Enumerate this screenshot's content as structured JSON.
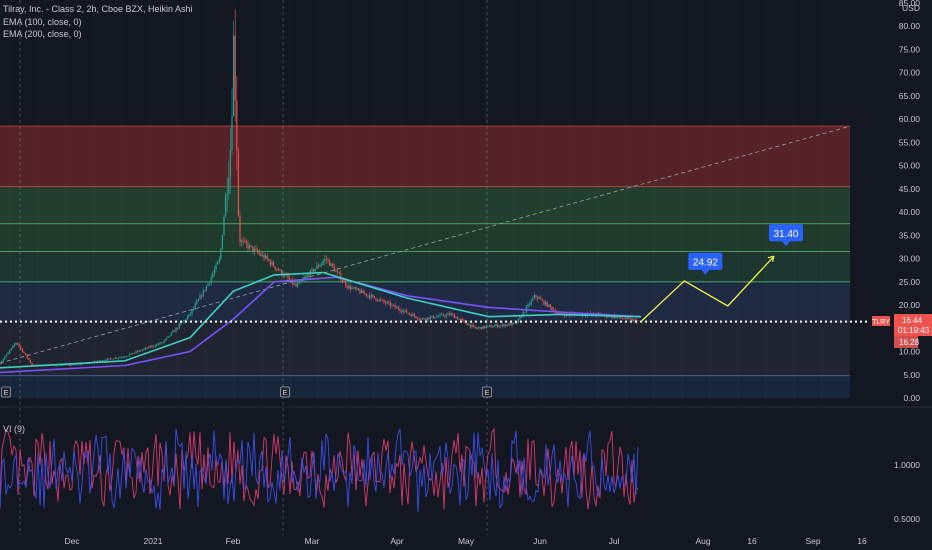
{
  "header": {
    "symbol_title": "Tilray, Inc. - Class 2, 2h, Cboe BZX, Heikin Ashi",
    "ema100_label": "EMA (100, close, 0)",
    "ema200_label": "EMA (200, close, 0)",
    "vi_label": "VI (9)"
  },
  "price_axis": {
    "currency": "USD",
    "ticks": [
      "85.00",
      "80.00",
      "75.00",
      "70.00",
      "65.00",
      "60.00",
      "55.00",
      "50.00",
      "45.00",
      "40.00",
      "35.00",
      "30.00",
      "25.00",
      "20.00",
      "15.00",
      "10.00",
      "5.00",
      "0.00"
    ],
    "tag_ticker": "TLRY",
    "tag_price": "16.44",
    "tag_countdown": "01:19:43",
    "tag_low": "16.28"
  },
  "vi_axis": {
    "ticks": [
      "1.0000",
      "0.5000"
    ]
  },
  "time_axis": {
    "labels": [
      "Dec",
      "2021",
      "Feb",
      "Mar",
      "Apr",
      "May",
      "Jun",
      "Jul",
      "Aug",
      "16",
      "Sep",
      "16"
    ]
  },
  "targets": {
    "target1": "24.92",
    "target2": "31.40"
  },
  "earnings_markers": [
    "E",
    "E",
    "E"
  ],
  "colors": {
    "up": "#26a69a",
    "down": "#ef5350",
    "ema100": "#3dd1c4",
    "ema200": "#7b52ff",
    "projection": "#f2ec4a",
    "target_label": "#2962ff",
    "vi_plus": "#3a4ee6",
    "vi_minus": "#d63a6a"
  },
  "chart_data": {
    "type": "candlestick",
    "title": "Tilray, Inc. - Class 2, 2h, Cboe BZX, Heikin Ashi",
    "ylabel": "USD",
    "ylim": [
      0,
      85
    ],
    "x_range": [
      "2020-11-16",
      "2021-09-25"
    ],
    "price_path": [
      {
        "date": "2020-11-16",
        "price": 7.5
      },
      {
        "date": "2020-11-22",
        "price": 12.0
      },
      {
        "date": "2020-11-28",
        "price": 7.0
      },
      {
        "date": "2020-12-15",
        "price": 7.2
      },
      {
        "date": "2021-01-01",
        "price": 9.0
      },
      {
        "date": "2021-01-15",
        "price": 12.0
      },
      {
        "date": "2021-01-25",
        "price": 18.0
      },
      {
        "date": "2021-02-01",
        "price": 25.0
      },
      {
        "date": "2021-02-05",
        "price": 30.0
      },
      {
        "date": "2021-02-09",
        "price": 55.0
      },
      {
        "date": "2021-02-10",
        "price": 77.0
      },
      {
        "date": "2021-02-11",
        "price": 60.0
      },
      {
        "date": "2021-02-12",
        "price": 34.0
      },
      {
        "date": "2021-02-22",
        "price": 30.0
      },
      {
        "date": "2021-03-05",
        "price": 24.0
      },
      {
        "date": "2021-03-16",
        "price": 30.0
      },
      {
        "date": "2021-03-24",
        "price": 24.0
      },
      {
        "date": "2021-04-05",
        "price": 21.0
      },
      {
        "date": "2021-04-20",
        "price": 17.0
      },
      {
        "date": "2021-05-01",
        "price": 18.0
      },
      {
        "date": "2021-05-10",
        "price": 15.0
      },
      {
        "date": "2021-05-25",
        "price": 16.0
      },
      {
        "date": "2021-06-01",
        "price": 22.0
      },
      {
        "date": "2021-06-10",
        "price": 18.0
      },
      {
        "date": "2021-06-25",
        "price": 18.0
      },
      {
        "date": "2021-07-05",
        "price": 17.0
      },
      {
        "date": "2021-07-09",
        "price": 16.44
      }
    ],
    "ema100": [
      {
        "date": "2020-11-16",
        "value": 6.5
      },
      {
        "date": "2021-01-01",
        "value": 8.0
      },
      {
        "date": "2021-01-25",
        "value": 13.0
      },
      {
        "date": "2021-02-10",
        "value": 23.0
      },
      {
        "date": "2021-02-25",
        "value": 26.5
      },
      {
        "date": "2021-03-15",
        "value": 27.0
      },
      {
        "date": "2021-04-15",
        "value": 21.5
      },
      {
        "date": "2021-05-15",
        "value": 17.5
      },
      {
        "date": "2021-06-10",
        "value": 18.0
      },
      {
        "date": "2021-07-10",
        "value": 17.5
      }
    ],
    "ema200": [
      {
        "date": "2020-11-16",
        "value": 5.5
      },
      {
        "date": "2021-01-01",
        "value": 7.0
      },
      {
        "date": "2021-01-25",
        "value": 10.0
      },
      {
        "date": "2021-02-10",
        "value": 17.0
      },
      {
        "date": "2021-02-25",
        "value": 25.0
      },
      {
        "date": "2021-03-20",
        "value": 26.0
      },
      {
        "date": "2021-04-15",
        "value": 22.0
      },
      {
        "date": "2021-05-15",
        "value": 19.5
      },
      {
        "date": "2021-06-10",
        "value": 18.5
      },
      {
        "date": "2021-07-10",
        "value": 17.5
      }
    ],
    "zones": [
      {
        "from": 45.5,
        "to": 58.5,
        "color": "#8b2b2b"
      },
      {
        "from": 37.5,
        "to": 45.5,
        "color": "#2d5e3a"
      },
      {
        "from": 31.5,
        "to": 37.5,
        "color": "#2c5733"
      },
      {
        "from": 25.0,
        "to": 31.5,
        "color": "#24503b"
      },
      {
        "from": 16.5,
        "to": 25.0,
        "color": "#263a5c"
      },
      {
        "from": 4.8,
        "to": 16.5,
        "color": "#2a2f3d"
      },
      {
        "from": 0,
        "to": 4.8,
        "color": "#1e3352"
      }
    ],
    "current_price": 16.44,
    "trendline": {
      "from": {
        "date": "2020-11-16",
        "price": 7.5
      },
      "to": {
        "date": "2021-09-25",
        "price": 58.5
      }
    },
    "projection": [
      {
        "date": "2021-07-10",
        "price": 16.44
      },
      {
        "date": "2021-07-26",
        "price": 25.2
      },
      {
        "date": "2021-08-11",
        "price": 19.8
      },
      {
        "date": "2021-08-28",
        "price": 30.5
      }
    ],
    "targets": [
      24.92,
      31.4
    ],
    "vi_ylim": [
      0.4,
      1.45
    ],
    "vi_range": [
      0.55,
      1.35
    ]
  }
}
